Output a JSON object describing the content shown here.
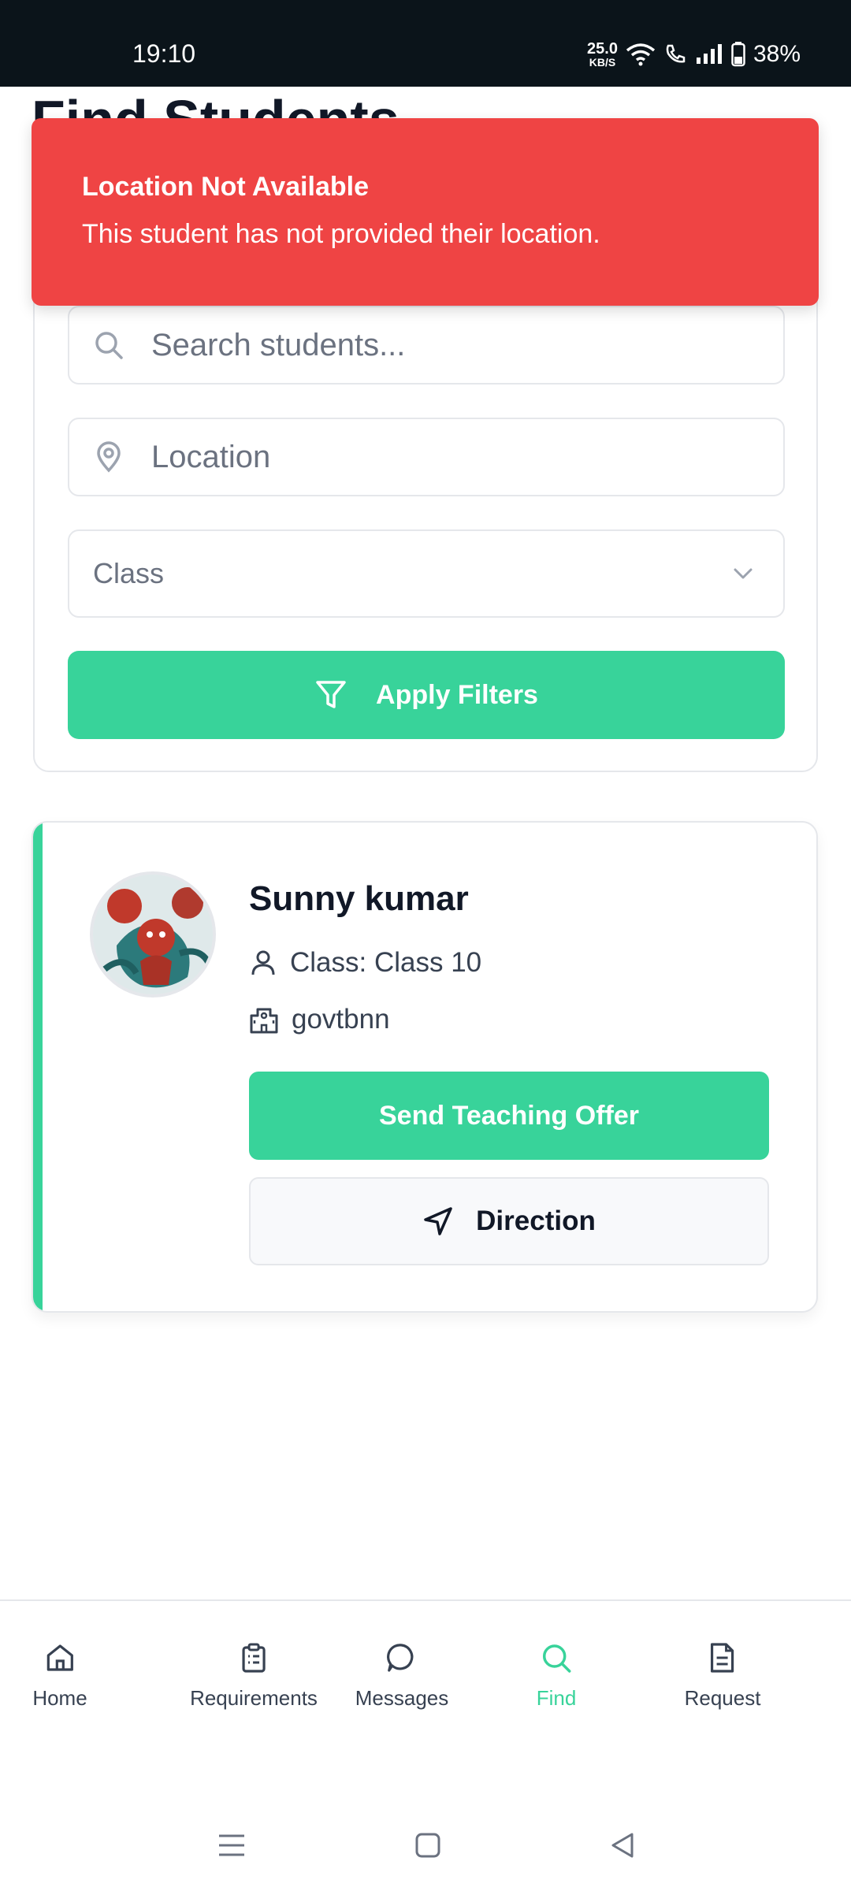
{
  "status_bar": {
    "time": "19:10",
    "net_speed_value": "25.0",
    "net_speed_unit": "KB/S",
    "battery": "38%"
  },
  "page": {
    "title": "Find Students"
  },
  "toast": {
    "title": "Location Not Available",
    "message": "This student has not provided their location.",
    "color": "#ef4444"
  },
  "filters": {
    "search_placeholder": "Search students...",
    "location_placeholder": "Location",
    "class_placeholder": "Class",
    "apply_label": "Apply Filters"
  },
  "student": {
    "name": "Sunny kumar",
    "class_text": "Class: Class 10",
    "school": "govtbnn",
    "offer_label": "Send Teaching Offer",
    "direction_label": "Direction"
  },
  "bottom_nav": {
    "items": [
      {
        "label": "Home",
        "icon": "home-icon"
      },
      {
        "label": "Requirements",
        "icon": "clipboard-icon"
      },
      {
        "label": "Messages",
        "icon": "chat-icon"
      },
      {
        "label": "Find",
        "icon": "search-icon",
        "active": true
      },
      {
        "label": "Request",
        "icon": "document-icon"
      }
    ]
  },
  "theme": {
    "accent": "#38d39a",
    "text": "#111827"
  }
}
